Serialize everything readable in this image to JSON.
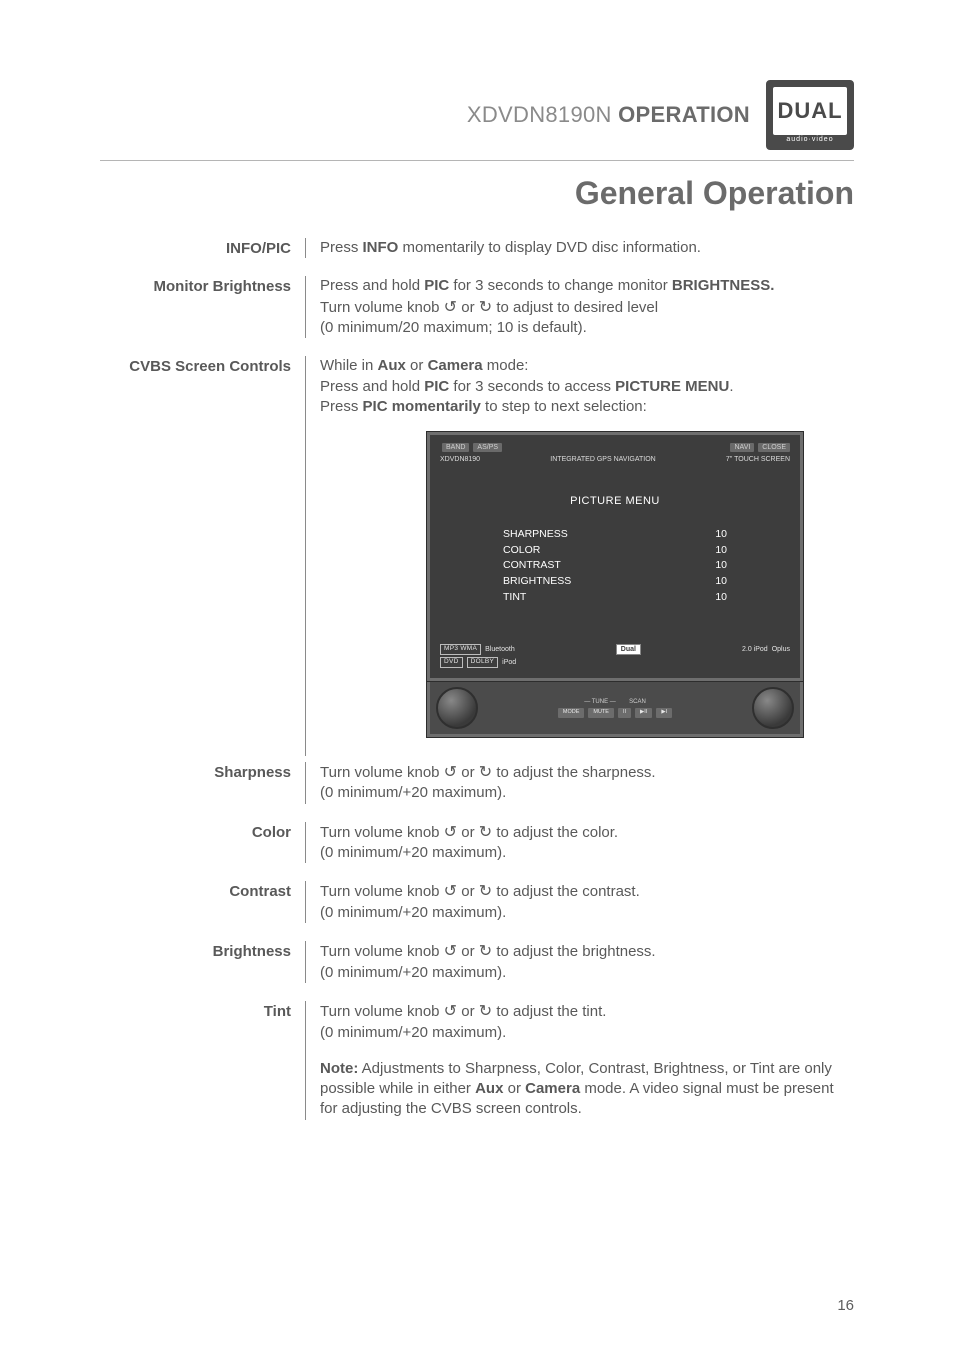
{
  "header": {
    "model": "XDVDN8190N",
    "word": "OPERATION",
    "logo_text": "DUAL",
    "logo_sub": "audio·video"
  },
  "section_title": "General Operation",
  "rows": {
    "info_pic": {
      "label": "INFO/PIC",
      "p1_a": "Press ",
      "p1_b": "INFO",
      "p1_c": " momentarily to display DVD disc information."
    },
    "monitor_brightness": {
      "label": "Monitor Brightness",
      "p1_a": "Press and hold ",
      "p1_b": "PIC",
      "p1_c": " for 3 seconds to change monitor ",
      "p1_d": "BRIGHTNESS.",
      "p2_a": "Turn volume knob ",
      "p2_b": " or ",
      "p2_c": " to adjust to desired level",
      "p3": "(0 minimum/20 maximum; 10 is default)."
    },
    "cvbs": {
      "label": "CVBS Screen Controls",
      "p1_a": "While in ",
      "p1_b": "Aux",
      "p1_c": " or ",
      "p1_d": "Camera",
      "p1_e": " mode:",
      "p2_a": "Press and hold ",
      "p2_b": "PIC",
      "p2_c": " for 3 seconds to access ",
      "p2_d": "PICTURE MENU",
      "p2_e": ".",
      "p3_a": "Press ",
      "p3_b": "PIC momentarily",
      "p3_c": " to step to next selection:"
    },
    "sharpness": {
      "label": "Sharpness",
      "p1_a": "Turn volume knob ",
      "p1_b": " or ",
      "p1_c": " to adjust the sharpness.",
      "p2": "(0 minimum/+20 maximum)."
    },
    "color": {
      "label": "Color",
      "p1_a": "Turn volume knob ",
      "p1_b": " or ",
      "p1_c": " to adjust the color.",
      "p2": "(0 minimum/+20 maximum)."
    },
    "contrast": {
      "label": "Contrast",
      "p1_a": "Turn volume knob ",
      "p1_b": " or ",
      "p1_c": " to adjust the contrast.",
      "p2": "(0 minimum/+20 maximum)."
    },
    "brightness": {
      "label": "Brightness",
      "p1_a": "Turn volume knob ",
      "p1_b": " or ",
      "p1_c": " to adjust the brightness.",
      "p2": "(0 minimum/+20 maximum)."
    },
    "tint": {
      "label": "Tint",
      "p1_a": "Turn volume knob ",
      "p1_b": " or ",
      "p1_c": " to adjust the tint.",
      "p2": "(0 minimum/+20 maximum)."
    },
    "note": {
      "b": "Note:",
      "t1": " Adjustments to Sharpness, Color, Contrast, Brightness, or Tint are only possible while in either ",
      "b2": "Aux",
      "t2": " or ",
      "b3": "Camera",
      "t3": " mode. A video signal must be present for adjusting the CVBS screen controls."
    }
  },
  "device": {
    "top_slots": [
      "BAND",
      "AS/PS",
      "NAVI",
      "CLOSE"
    ],
    "subbar_left": "XDVDN8190",
    "subbar_center": "INTEGRATED GPS NAVIGATION",
    "subbar_right": "7\" TOUCH SCREEN",
    "menu_title": "PICTURE MENU",
    "menu": [
      {
        "name": "SHARPNESS",
        "val": "10"
      },
      {
        "name": "COLOR",
        "val": "10"
      },
      {
        "name": "CONTRAST",
        "val": "10"
      },
      {
        "name": "BRIGHTNESS",
        "val": "10"
      },
      {
        "name": "TINT",
        "val": "10"
      }
    ],
    "badges_left": [
      "MP3 WMA",
      "Bluetooth"
    ],
    "badges_center": "Dual",
    "badges_right": [
      "2.0 iPod",
      "Oplus"
    ],
    "panel_strip": [
      "DVD",
      "DOLBY",
      "iPod"
    ],
    "panel_label_tune": "— TUNE —",
    "panel_label_scan": "SCAN",
    "panel_buttons": [
      "MODE",
      "MUTE",
      "II",
      "▶II",
      "▶I"
    ]
  },
  "icons": {
    "ccw": "↺",
    "cw": "↻"
  },
  "page_number": "16"
}
